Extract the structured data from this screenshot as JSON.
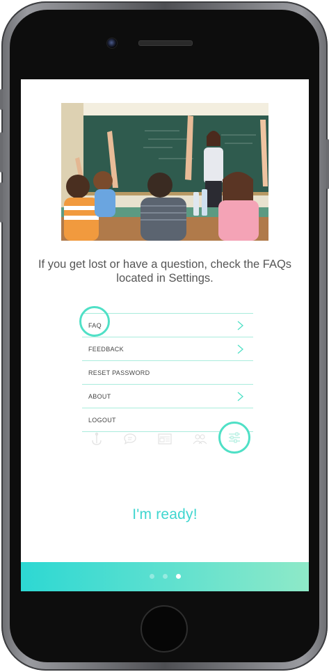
{
  "intro_text": "If you get lost or have a question, check the FAQs located in Settings.",
  "settings_menu": {
    "items": [
      {
        "label": "FAQ",
        "has_chevron": true,
        "highlighted": true
      },
      {
        "label": "FEEDBACK",
        "has_chevron": true
      },
      {
        "label": "RESET PASSWORD",
        "has_chevron": false
      },
      {
        "label": "ABOUT",
        "has_chevron": true
      },
      {
        "label": "LOGOUT",
        "has_chevron": false
      }
    ]
  },
  "tab_bar": {
    "tabs": [
      {
        "icon": "anchor-icon"
      },
      {
        "icon": "chat-bubble-icon"
      },
      {
        "icon": "newspaper-icon"
      },
      {
        "icon": "people-icon"
      },
      {
        "icon": "sliders-icon",
        "active": true
      }
    ]
  },
  "ready_button": {
    "label": "I'm ready!"
  },
  "pager": {
    "count": 3,
    "current": 3
  },
  "colors": {
    "accent": "#4fe0c6",
    "ready_text": "#3fd6cf",
    "footer_gradient_start": "#2dd8d3",
    "footer_gradient_end": "#8ee9c8",
    "divider": "#a8ecdc"
  }
}
